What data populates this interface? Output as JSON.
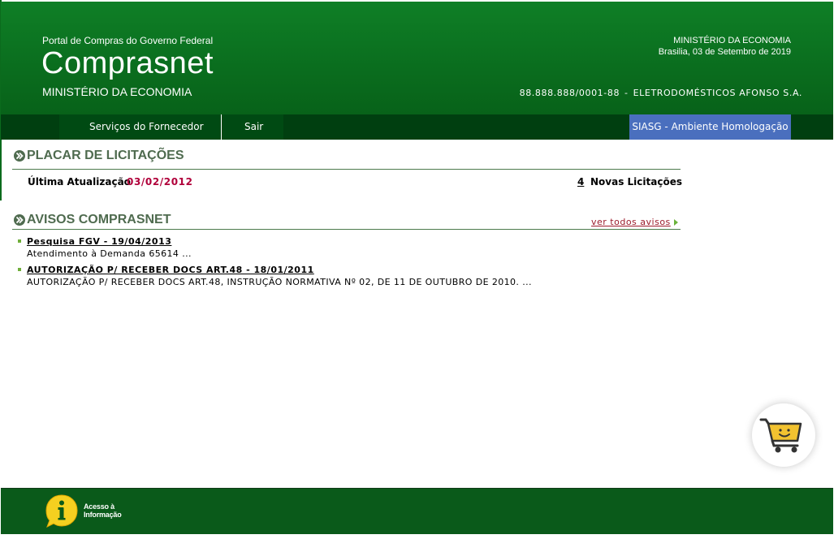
{
  "header": {
    "portal_subtitle": "Portal de Compras do Governo Federal",
    "brand": "Comprasnet",
    "ministry": "MINISTÉRIO DA ECONOMIA",
    "ministry_right": "MINISTÉRIO DA ECONOMIA",
    "date": "Brasilia, 03 de Setembro de 2019",
    "cnpj": "88.888.888/0001-88",
    "separator": "-",
    "company": "ELETRODOMÉSTICOS AFONSO S.A."
  },
  "nav": {
    "items": [
      {
        "label": "Serviços do Fornecedor"
      },
      {
        "label": "Sair"
      }
    ],
    "environment": "SIASG - Ambiente Homologação"
  },
  "placar": {
    "title": "PLACAR DE LICITAÇÕES",
    "last_update_label": "Última Atualização",
    "last_update_date": "03/02/2012",
    "new_count": "4",
    "new_label": "Novas Licitações"
  },
  "avisos": {
    "title": "AVISOS COMPRASNET",
    "see_all": "ver todos avisos",
    "items": [
      {
        "title": "Pesquisa FGV - 19/04/2013",
        "desc": "Atendimento à Demanda 65614 ..."
      },
      {
        "title": "AUTORIZAÇÃO P/ RECEBER DOCS ART.48 - 18/01/2011",
        "desc": "AUTORIZAÇÃO P/ RECEBER DOCS ART.48, INSTRUÇÃO NORMATIVA Nº 02, DE 11 DE OUTUBRO DE 2010. ..."
      }
    ]
  },
  "footer": {
    "access_info": "Acesso à\nInformação"
  },
  "icons": {
    "section": "chevron-double-right-icon",
    "cart": "shopping-cart-icon",
    "info": "info-icon"
  },
  "colors": {
    "header_green": "#0a6d1e",
    "nav_dark": "#003f10",
    "env_blue": "#4a6fbe",
    "section_title": "#4f6b4f",
    "date_red": "#b0003a",
    "footer_green": "#0a5a1a",
    "cart_yellow": "#f2c230"
  }
}
